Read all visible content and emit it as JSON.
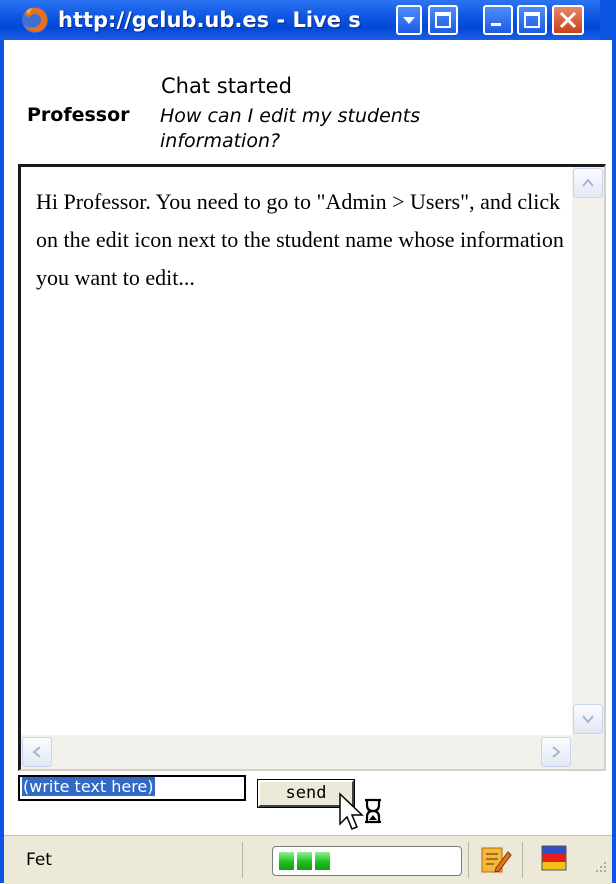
{
  "window": {
    "title": "http://gclub.ub.es - Live s",
    "icons": [
      "firefox-icon",
      "menu-arrow-icon",
      "restore-icon",
      "minimize-icon",
      "maximize-icon",
      "close-icon"
    ]
  },
  "header": {
    "status": "Chat started",
    "user": "Professor",
    "question": "How can I edit my students information?"
  },
  "chat": {
    "message": "Hi Professor. You need to go to \"Admin > Users\", and click on the edit icon next to the student name whose information you want to edit..."
  },
  "input": {
    "value": "(write text here)",
    "send_label": "send"
  },
  "statusbar": {
    "text": "Fet",
    "progress": 0.3,
    "icons": [
      "notes-icon",
      "flag-icon",
      "resize-grip-icon"
    ]
  },
  "colors": {
    "titlebar": "#0b54e0",
    "progress": "#20c020",
    "selection": "#316ac5"
  }
}
